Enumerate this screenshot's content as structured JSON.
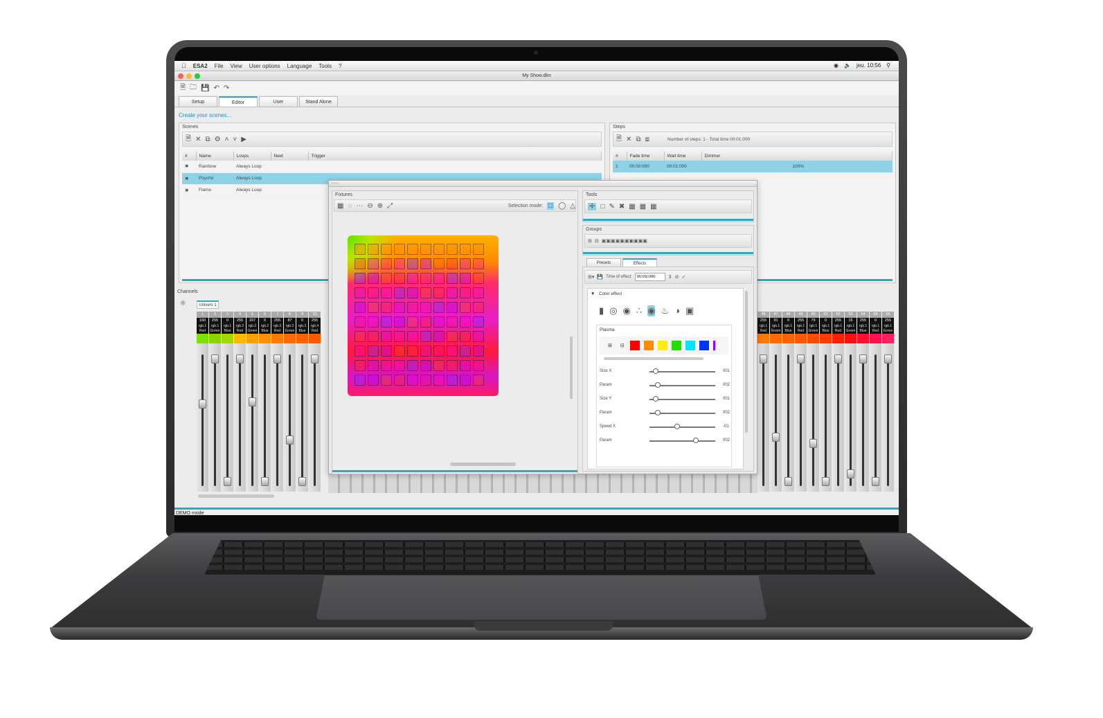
{
  "menubar": {
    "app": "ESA2",
    "items": [
      "File",
      "View",
      "User options",
      "Language",
      "Tools",
      "?"
    ],
    "clock": "jeu. 10:56"
  },
  "window": {
    "title": "My Show.dlm"
  },
  "tabs": [
    "Setup",
    "Editor",
    "User",
    "Stand Alone"
  ],
  "help_text": "Create your scenes...",
  "scenes": {
    "title": "Scenes",
    "columns": [
      "#",
      "Name",
      "Loops",
      "Next",
      "Trigger"
    ],
    "rows": [
      {
        "name": "Rainbow",
        "loops": "Always Loop"
      },
      {
        "name": "Psycho",
        "loops": "Always Loop"
      },
      {
        "name": "Flame",
        "loops": "Always Loop"
      }
    ]
  },
  "steps": {
    "title": "Steps",
    "summary": "Number of steps: 1 - Total time 00:01:000",
    "columns": [
      "#",
      "Fade time",
      "Wait time",
      "Dimmer"
    ],
    "rows": [
      {
        "n": "1",
        "fade": "00:00:000",
        "wait": "00:01:000",
        "dimmer": "100%"
      }
    ]
  },
  "channels": {
    "title": "Channels",
    "universe": "Univers 1",
    "left": [
      {
        "n": "1",
        "v": "160",
        "name": "rgb.1 Red",
        "color": "#7ee000",
        "level": 0.63
      },
      {
        "n": "2",
        "v": "255",
        "name": "rgb.1 Green",
        "color": "#8ad400",
        "level": 1.0
      },
      {
        "n": "3",
        "v": "0",
        "name": "rgb.1 Blue",
        "color": "#a6d600",
        "level": 0.0
      },
      {
        "n": "4",
        "v": "255",
        "name": "rgb.2 Red",
        "color": "#ffb800",
        "level": 1.0
      },
      {
        "n": "5",
        "v": "167",
        "name": "rgb.2 Green",
        "color": "#ffa000",
        "level": 0.65
      },
      {
        "n": "6",
        "v": "0",
        "name": "rgb.2 Blue",
        "color": "#ff9000",
        "level": 0.0
      },
      {
        "n": "7",
        "v": "255",
        "name": "rgb.3 Red",
        "color": "#ff7a00",
        "level": 1.0
      },
      {
        "n": "8",
        "v": "87",
        "name": "rgb.3 Green",
        "color": "#ff6a00",
        "level": 0.34
      },
      {
        "n": "9",
        "v": "0",
        "name": "rgb.3 Blue",
        "color": "#ff6000",
        "level": 0.0
      },
      {
        "n": "10",
        "v": "255",
        "name": "rgb.4 Red",
        "color": "#ff5800",
        "level": 1.0
      }
    ],
    "right": [
      {
        "n": "46",
        "v": "255",
        "name": "rgb.1 Red",
        "color": "#ff7a00",
        "level": 1.0
      },
      {
        "n": "47",
        "v": "91",
        "name": "rgb.1 Green",
        "color": "#ff6a00",
        "level": 0.36
      },
      {
        "n": "48",
        "v": "0",
        "name": "rgb.1 Blue",
        "color": "#ff6000",
        "level": 0.0
      },
      {
        "n": "49",
        "v": "255",
        "name": "rgb.1 Red",
        "color": "#ff5800",
        "level": 1.0
      },
      {
        "n": "50",
        "v": "79",
        "name": "rgb.1 Green",
        "color": "#ff4a00",
        "level": 0.31
      },
      {
        "n": "51",
        "v": "0",
        "name": "rgb.1 Blue",
        "color": "#ff3a00",
        "level": 0.0
      },
      {
        "n": "52",
        "v": "255",
        "name": "rgb.1 Red",
        "color": "#ff2000",
        "level": 1.0
      },
      {
        "n": "53",
        "v": "15",
        "name": "rgb.1 Green",
        "color": "#ff1010",
        "level": 0.06
      },
      {
        "n": "54",
        "v": "255",
        "name": "rgb.1 Blue",
        "color": "#ff1030",
        "level": 1.0
      },
      {
        "n": "55",
        "v": "0",
        "name": "rgb.1 Red",
        "color": "#ff1050",
        "level": 0.0
      },
      {
        "n": "56",
        "v": "255",
        "name": "rgb.1 Green",
        "color": "#ff2060",
        "level": 1.0
      }
    ]
  },
  "fixtures": {
    "title": "Fixtures",
    "selection_mode_label": "Selection mode:"
  },
  "tools": {
    "title": "Tools"
  },
  "groups": {
    "title": "Groups"
  },
  "effect_tabs": [
    "Presets",
    "Effects"
  ],
  "effects": {
    "time_label": "Time of effect:",
    "time_value": "00:05:000",
    "section": "Color effect",
    "plasma_title": "Plasma",
    "palette": [
      "#ff0000",
      "#ff8c00",
      "#ffee00",
      "#22dd00",
      "#00e5ff",
      "#0033ff",
      "#9900ff"
    ],
    "sliders": [
      {
        "label": "Size X",
        "value": "001",
        "pos": 0.05
      },
      {
        "label": "Param",
        "value": "002",
        "pos": 0.09
      },
      {
        "label": "Size Y",
        "value": "001",
        "pos": 0.05
      },
      {
        "label": "Param",
        "value": "002",
        "pos": 0.09
      },
      {
        "label": "Speed X",
        "value": "-01",
        "pos": 0.4
      },
      {
        "label": "Param",
        "value": "002",
        "pos": 0.7
      }
    ]
  },
  "status": "DEMO mode"
}
